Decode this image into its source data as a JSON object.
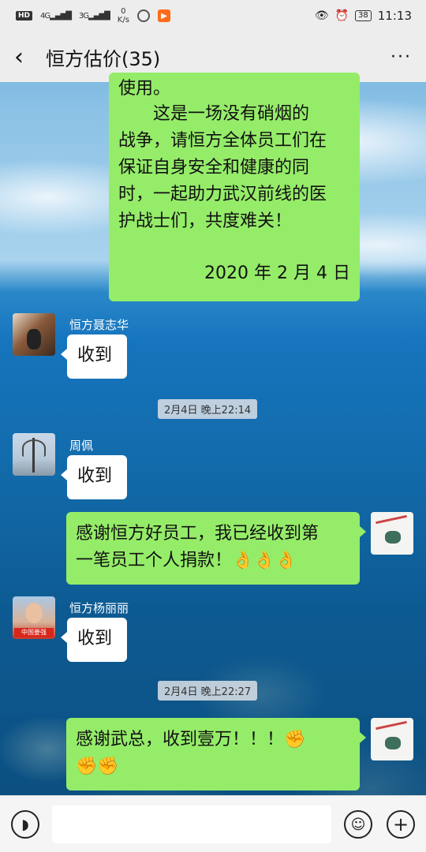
{
  "status_bar": {
    "hd": "HD",
    "signal1": "4G",
    "signal2": "3G",
    "net_speed_value": "0",
    "net_speed_unit": "K/s",
    "battery": "38",
    "time": "11:13"
  },
  "header": {
    "back_icon": "chevron-left-icon",
    "title": "恒方估价(35)",
    "more_icon": "more-dots-icon"
  },
  "messages": [
    {
      "type": "outgoing",
      "lines": [
        "使用。",
        "　　这是一场没有硝烟的",
        "战争，请恒方全体员工们在",
        "保证自身安全和健康的同",
        "时，一起助力武汉前线的医",
        "护战士们，共度难关！",
        "",
        "2020 年 2 月 4 日"
      ]
    },
    {
      "type": "incoming",
      "sender": "恒方聂志华",
      "text": "收到"
    },
    {
      "type": "time",
      "text": "2月4日 晚上22:14"
    },
    {
      "type": "incoming",
      "sender": "周佩",
      "text": "收到"
    },
    {
      "type": "outgoing",
      "lines": [
        "感谢恒方好员工，我已经收到第",
        "一笔员工个人捐款！👌👌👌"
      ]
    },
    {
      "type": "incoming",
      "sender": "恒方杨丽丽",
      "avatar_badge": "中国要强",
      "text": "收到"
    },
    {
      "type": "time",
      "text": "2月4日 晚上22:27"
    },
    {
      "type": "outgoing",
      "lines": [
        "感谢武总，收到壹万！！！✊",
        "✊✊"
      ]
    }
  ],
  "input_bar": {
    "voice_icon": "voice-icon",
    "emoji_icon": "emoji-icon",
    "plus_icon": "plus-icon",
    "placeholder": ""
  },
  "colors": {
    "outgoing_bubble": "#95ec69",
    "incoming_bubble": "#ffffff",
    "bar_background": "#ededed"
  }
}
